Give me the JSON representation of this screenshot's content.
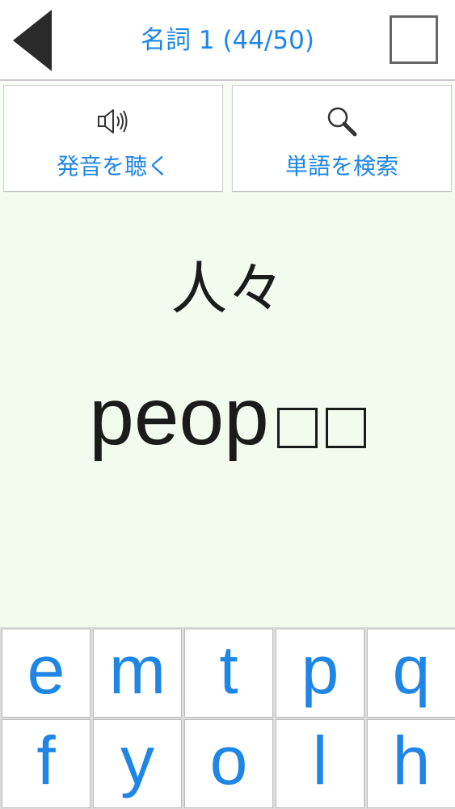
{
  "header": {
    "title": "名詞 1 (44/50)",
    "back_icon": "back-triangle-icon",
    "check_icon": "checkbox-icon"
  },
  "actions": {
    "listen_label": "発音を聴く",
    "listen_icon": "speaker-icon",
    "search_label": "単語を検索",
    "search_icon": "magnifier-icon"
  },
  "card": {
    "japanese": "人々",
    "answer_typed": "peop",
    "answer_blank_count": 2
  },
  "keyboard": {
    "row1": [
      "e",
      "m",
      "t",
      "p",
      "q"
    ],
    "row2": [
      "f",
      "y",
      "o",
      "l",
      "h"
    ]
  },
  "colors": {
    "accent": "#1f86e6",
    "card_background": "#f3fbef",
    "text": "#1b1b1b"
  }
}
